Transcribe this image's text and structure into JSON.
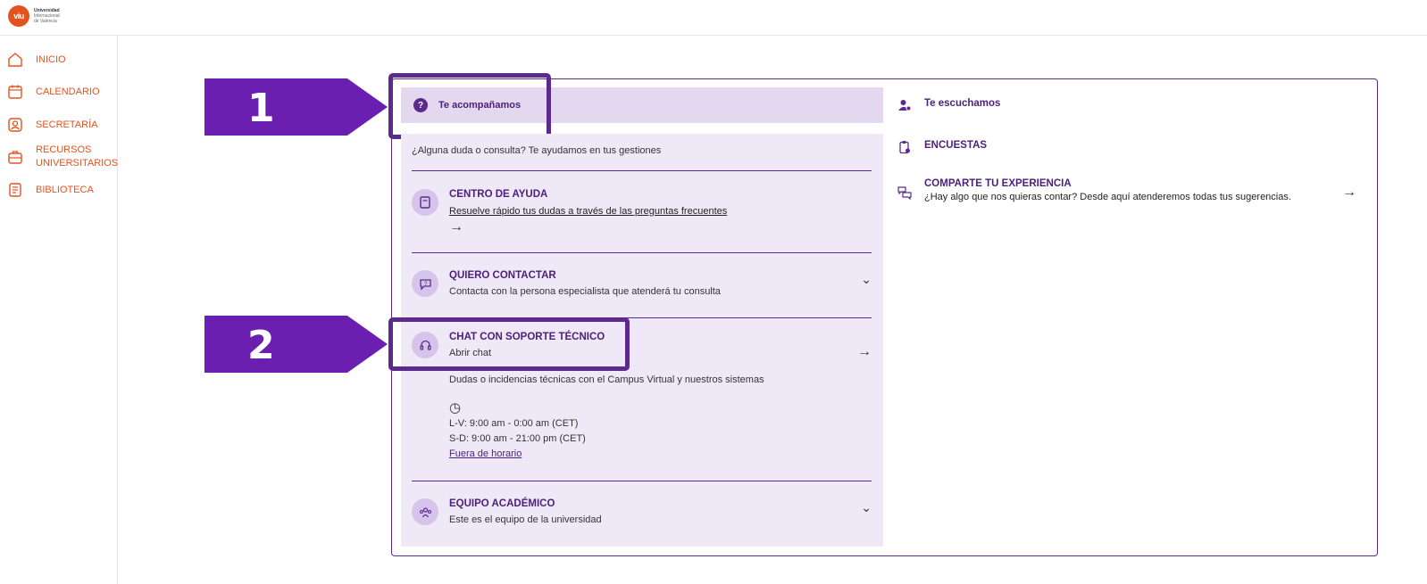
{
  "brand": {
    "logo_mark": "viu",
    "logo_line1": "Universidad",
    "logo_line2": "Internacional",
    "logo_line3": "de Valencia"
  },
  "sidebar": {
    "items": [
      {
        "label": "INICIO",
        "icon": "home-icon"
      },
      {
        "label": "CALENDARIO",
        "icon": "calendar-icon"
      },
      {
        "label": "SECRETARÍA",
        "icon": "user-badge-icon"
      },
      {
        "label": "RECURSOS UNIVERSITARIOS",
        "icon": "briefcase-icon"
      },
      {
        "label": "BIBLIOTECA",
        "icon": "book-icon"
      }
    ]
  },
  "annotations": {
    "step1": "1",
    "step2": "2"
  },
  "left": {
    "tab_label": "Te acompañamos",
    "intro": "¿Alguna duda o consulta? Te ayudamos en tus gestiones",
    "help": {
      "title": "CENTRO DE AYUDA",
      "sub": "Resuelve rápido tus dudas a través de las preguntas frecuentes",
      "arrow": "→"
    },
    "contact": {
      "title": "QUIERO CONTACTAR",
      "sub": "Contacta con la persona especialista que atenderá tu consulta",
      "chev": "⌄"
    },
    "chat": {
      "title": "CHAT CON SOPORTE TÉCNICO",
      "sub": "Abrir chat",
      "desc": "Dudas o incidencias técnicas con el Campus Virtual y nuestros sistemas",
      "clock": "◷",
      "hours1": "L-V: 9:00 am - 0:00 am (CET)",
      "hours2": "S-D: 9:00 am - 21:00 pm (CET)",
      "after_hours": "Fuera de horario",
      "arrow": "→"
    },
    "academic": {
      "title": "EQUIPO ACADÉMICO",
      "sub": "Este es el equipo de la universidad",
      "chev": "⌄"
    }
  },
  "right": {
    "tab_label": "Te escuchamos",
    "surveys": "ENCUESTAS",
    "share": {
      "title": "COMPARTE TU EXPERIENCIA",
      "sub": "¿Hay algo que nos quieras contar? Desde aquí atenderemos todas tus sugerencias.",
      "arrow": "→"
    }
  }
}
